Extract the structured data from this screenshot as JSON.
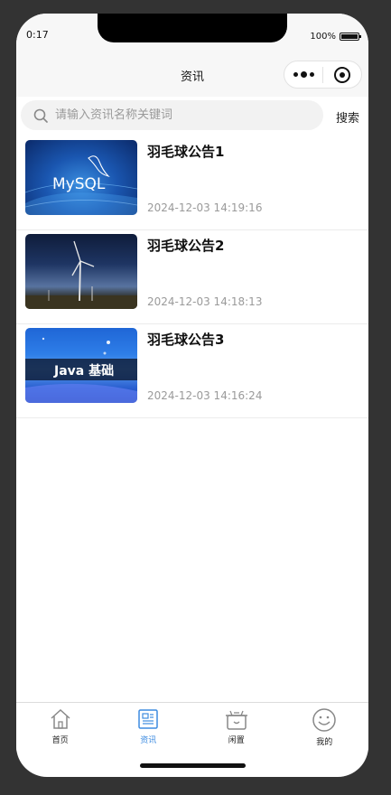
{
  "status": {
    "time": "0:17",
    "battery": "100%"
  },
  "nav": {
    "title": "资讯"
  },
  "search": {
    "placeholder": "请输入资讯名称关键词",
    "button": "搜索"
  },
  "news": [
    {
      "title": "羽毛球公告1",
      "time": "2024-12-03 14:19:16",
      "image_text": "MySQL"
    },
    {
      "title": "羽毛球公告2",
      "time": "2024-12-03 14:18:13",
      "image_text": ""
    },
    {
      "title": "羽毛球公告3",
      "time": "2024-12-03 14:16:24",
      "image_text": "Java 基础"
    }
  ],
  "tabs": [
    {
      "label": "首页",
      "icon": "home-icon"
    },
    {
      "label": "资讯",
      "icon": "news-icon",
      "active": true
    },
    {
      "label": "闲置",
      "icon": "idle-icon"
    },
    {
      "label": "我的",
      "icon": "profile-icon"
    }
  ],
  "colors": {
    "accent": "#3d8be0",
    "background": "#333333"
  }
}
